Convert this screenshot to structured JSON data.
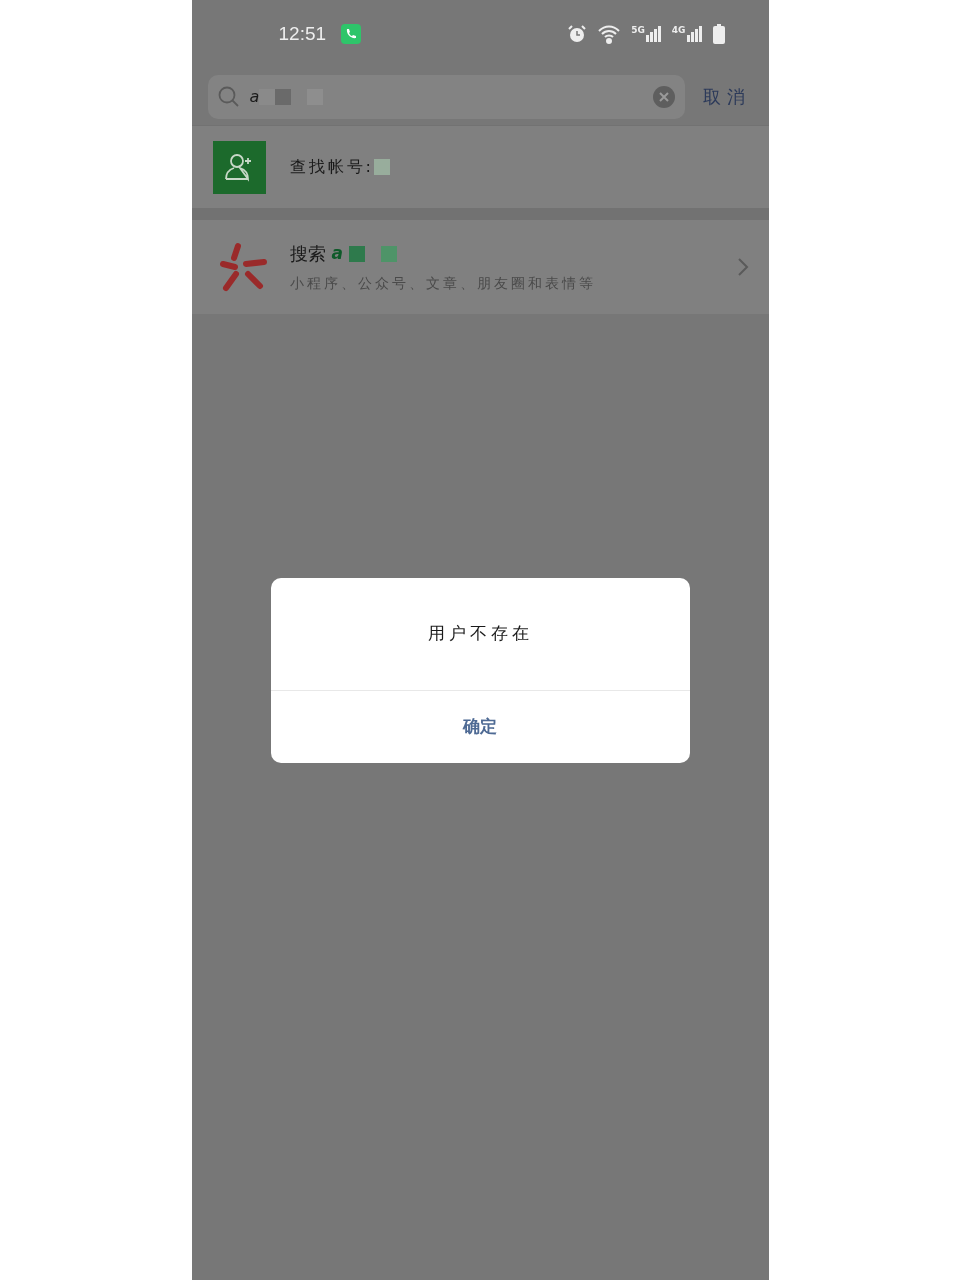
{
  "status_bar": {
    "time": "12:51",
    "network_labels": [
      "5G",
      "4G"
    ]
  },
  "search": {
    "value": "a",
    "cancel": "取消"
  },
  "results": [
    {
      "kind": "account",
      "label": "查找帐号:"
    },
    {
      "kind": "search",
      "title": "搜索",
      "query": "a",
      "subtitle": "小程序、公众号、文章、朋友圈和表情等"
    }
  ],
  "dialog": {
    "message": "用户不存在",
    "button": "确定"
  }
}
